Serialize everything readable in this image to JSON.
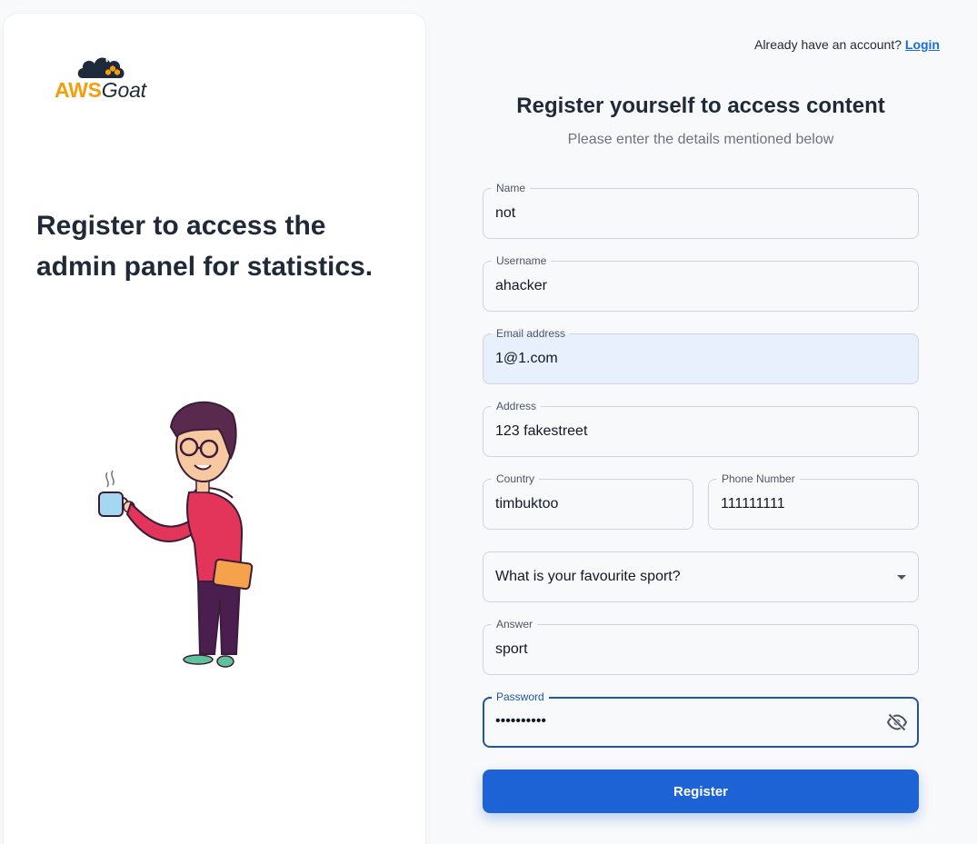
{
  "brand": {
    "aws": "AWS",
    "goat": "Goat"
  },
  "left": {
    "heading": "Register to access the admin panel for statistics."
  },
  "top": {
    "prompt": "Already have an account? ",
    "login_label": "Login"
  },
  "form": {
    "title": "Register yourself to access content",
    "subtitle": "Please enter the details mentioned below",
    "fields": {
      "name": {
        "label": "Name",
        "value": "not"
      },
      "username": {
        "label": "Username",
        "value": "ahacker"
      },
      "email": {
        "label": "Email address",
        "value": "1@1.com"
      },
      "address": {
        "label": "Address",
        "value": "123 fakestreet"
      },
      "country": {
        "label": "Country",
        "value": "timbuktoo"
      },
      "phone": {
        "label": "Phone Number",
        "value": "111111111"
      },
      "security_question": {
        "value": "What is your favourite sport?"
      },
      "answer": {
        "label": "Answer",
        "value": "sport"
      },
      "password": {
        "label": "Password",
        "value": "••••••••••"
      }
    },
    "submit_label": "Register"
  },
  "colors": {
    "accent": "#1d63d6",
    "brand_orange": "#f59e0b",
    "autofill_bg": "#e8f0fe"
  },
  "icons": {
    "logo": "goat-cloud-logo",
    "password_toggle": "eye-off-icon",
    "select": "caret-down-icon"
  }
}
